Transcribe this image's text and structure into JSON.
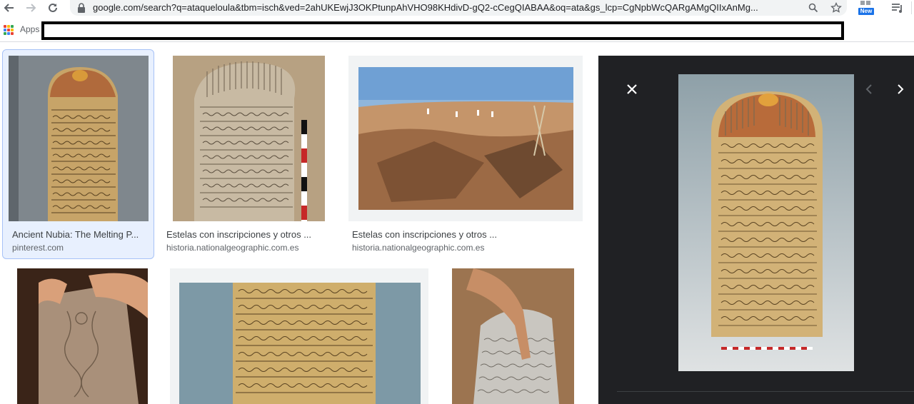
{
  "browser": {
    "url": "google.com/search?q=ataqueloula&tbm=isch&ved=2ahUKEwjJ3OKPtunpAhVHO98KHdivD-gQ2-cCegQIABAA&oq=ata&gs_lcp=CgNpbWcQARgAMgQIIxAnMg...",
    "bookmarks_apps_label": "Apps",
    "extension_badge": "New",
    "icons": [
      "back-icon",
      "forward-icon",
      "reload-icon",
      "lock-icon",
      "zoom-icon",
      "star-icon",
      "extension-icon",
      "playlist-icon"
    ]
  },
  "results": [
    {
      "title": "Ancient Nubia: The Melting P...",
      "domain": "pinterest.com",
      "selected": true
    },
    {
      "title": "Estelas con inscripciones y otros ...",
      "domain": "historia.nationalgeographic.com.es",
      "selected": false
    },
    {
      "title": "Estelas con inscripciones y otros ...",
      "domain": "historia.nationalgeographic.com.es",
      "selected": false
    }
  ],
  "colors": {
    "accent": "#1a73e8",
    "preview_bg": "#202124",
    "selected_bg": "#e8f0fe",
    "stone": "#c9a56a"
  }
}
